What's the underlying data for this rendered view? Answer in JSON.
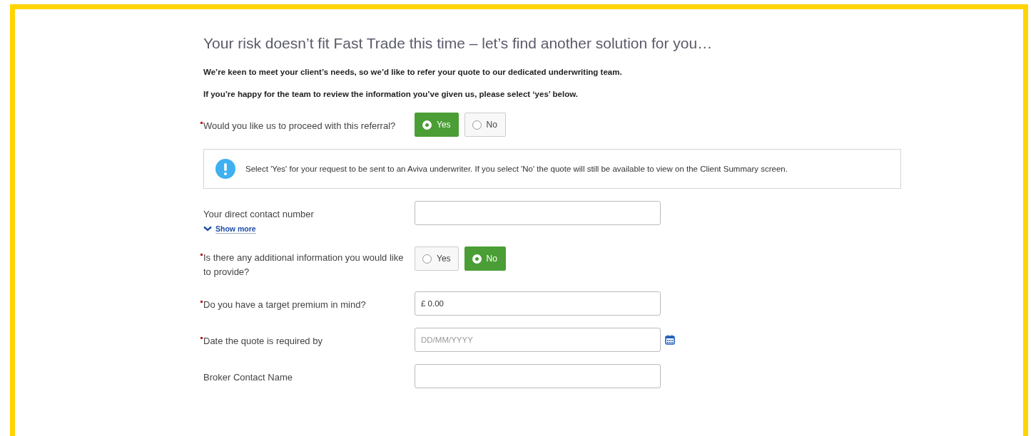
{
  "heading": "Your risk doesn’t fit Fast Trade this time – let’s find another solution for you…",
  "intro": [
    "We’re keen to meet your client’s needs, so we’d like to refer your quote to our dedicated underwriting team.",
    "If you’re happy for the team to review the information you’ve given us, please select ‘yes’ below."
  ],
  "rows": [
    {
      "kind": "radio",
      "required": true,
      "label": "Would you like us to proceed with this referral?",
      "options": [
        {
          "label": "Yes",
          "selected": true
        },
        {
          "label": "No",
          "selected": false
        }
      ]
    },
    {
      "kind": "info",
      "text": "Select 'Yes' for your request to be sent to an Aviva underwriter. If you select 'No' the quote will still be available to view on the Client Summary screen."
    },
    {
      "kind": "text",
      "required": false,
      "label": "Your direct contact number",
      "link": "Show more"
    },
    {
      "kind": "radio",
      "required": true,
      "label": "Is there any additional information you would like to provide?",
      "options": [
        {
          "label": "Yes",
          "selected": false
        },
        {
          "label": "No",
          "selected": true
        }
      ]
    },
    {
      "kind": "text",
      "required": true,
      "label": "Do you have a target premium in mind?",
      "value": "£ 0.00"
    },
    {
      "kind": "date",
      "required": true,
      "label": "Date the quote is required by",
      "placeholder": "DD/MM/YYYY"
    },
    {
      "kind": "text",
      "required": false,
      "label": "Broker Contact Name"
    }
  ]
}
